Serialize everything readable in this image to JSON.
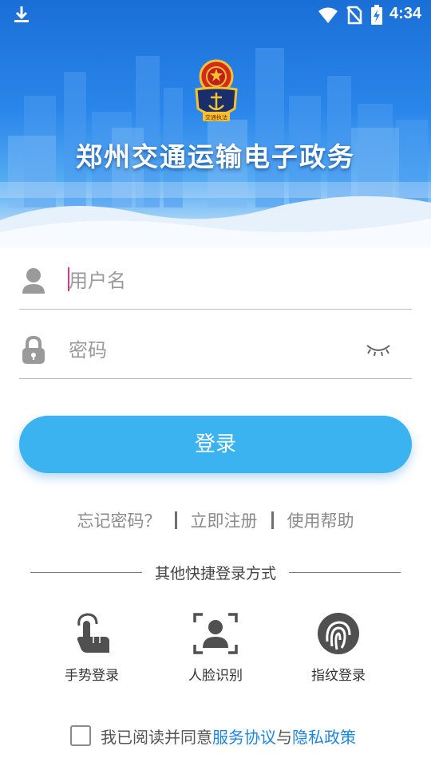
{
  "status_bar": {
    "time": "4:34",
    "icons": [
      "download-icon",
      "wifi-icon",
      "no-sim-icon",
      "battery-charging-icon"
    ]
  },
  "header": {
    "emblem_text": "交通执法",
    "title": "郑州交通运输电子政务"
  },
  "form": {
    "username_placeholder": "用户名",
    "password_placeholder": "密码",
    "username_value": "",
    "password_value": ""
  },
  "login_button": "登录",
  "links": {
    "forgot": "忘记密码？",
    "register": "立即注册",
    "help": "使用帮助"
  },
  "quick_login": {
    "heading": "其他快捷登录方式",
    "items": [
      {
        "label": "手势登录",
        "icon": "gesture-icon"
      },
      {
        "label": "人脸识别",
        "icon": "face-recognition-icon"
      },
      {
        "label": "指纹登录",
        "icon": "fingerprint-icon"
      }
    ]
  },
  "agreement": {
    "prefix": "我已阅读并同意",
    "service": "服务协议",
    "joiner": "与",
    "privacy": "隐私政策",
    "checked": false
  },
  "colors": {
    "accent": "#3bb3f0",
    "link": "#1f86e0",
    "hero_top": "#1a6fd6"
  }
}
